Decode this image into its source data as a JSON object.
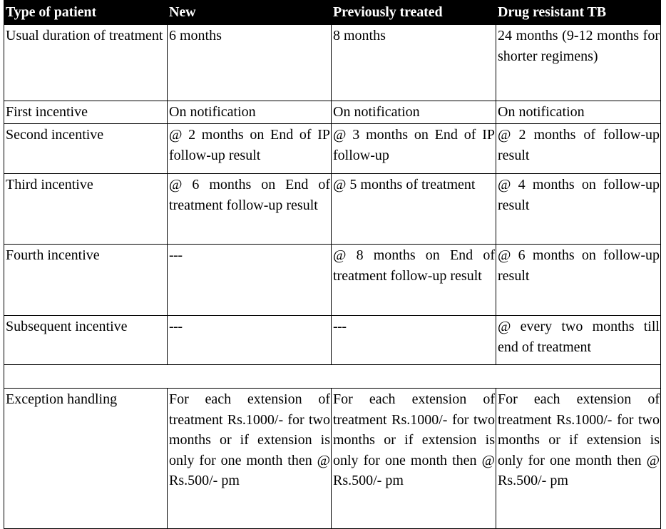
{
  "table": {
    "columns": [
      {
        "key": "type",
        "label": "Type of patient"
      },
      {
        "key": "new",
        "label": "New"
      },
      {
        "key": "previously_treated",
        "label": "Previously treated"
      },
      {
        "key": "drug_resistant",
        "label": "Drug resistant TB"
      }
    ],
    "rows": [
      {
        "id": "usual-duration-of-treatment",
        "type": "Usual duration of treatment",
        "new": "6 months",
        "previously_treated": "8 months",
        "drug_resistant": "24 months (9-12 months for shorter regimens)"
      },
      {
        "id": "first-incentive",
        "type": "First incentive",
        "new": "On notification",
        "previously_treated": "On notification",
        "drug_resistant": "On notification"
      },
      {
        "id": "second-incentive",
        "type": "Second incentive",
        "new": "@ 2 months on End of IP follow-up result",
        "previously_treated": "@ 3 months on End of IP follow-up",
        "drug_resistant": "@ 2 months of follow-up result"
      },
      {
        "id": "third-incentive",
        "type": "Third incentive",
        "new": "@ 6 months on End of treatment follow-up result",
        "previously_treated": "@ 5 months of treatment",
        "drug_resistant": "@ 4 months on follow-up result"
      },
      {
        "id": "fourth-incentive",
        "type": "Fourth incentive",
        "new": "---",
        "previously_treated": "@ 8 months on End of treatment follow-up result",
        "drug_resistant": "@ 6 months on follow-up result"
      },
      {
        "id": "subsequent-incentive",
        "type": "Subsequent incentive",
        "new": "---",
        "previously_treated": "---",
        "drug_resistant": "@ every two months till end of treatment"
      },
      {
        "id": "spacer",
        "type": "",
        "new": "",
        "previously_treated": "",
        "drug_resistant": ""
      },
      {
        "id": "exception-handling",
        "type": "Exception handling",
        "new": "For each extension of treatment Rs.1000/- for two months or if extension is only for one month then @ Rs.500/- pm",
        "previously_treated": "For each extension of treatment Rs.1000/- for two months or if extension is only for one month then @ Rs.500/- pm",
        "drug_resistant": "For each extension of treatment Rs.1000/- for two months or if extension is only for one month then @ Rs.500/- pm"
      }
    ]
  },
  "colors": {
    "header_background": "#000000",
    "header_text": "#ffffff",
    "border": "#000000",
    "body_background": "#ffffff",
    "body_text": "#000000"
  }
}
